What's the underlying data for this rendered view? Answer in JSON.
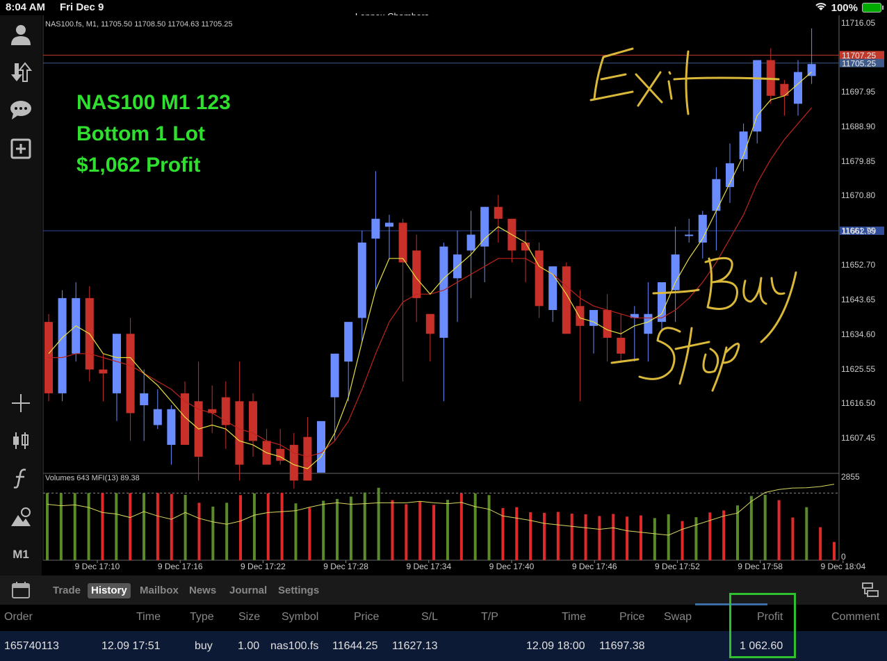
{
  "status_bar": {
    "time": "8:04 AM",
    "date": "Fri Dec 9",
    "title": "Lennox Chambers",
    "battery": "100%"
  },
  "sidebar": {
    "timeframe": "M1",
    "icons": [
      "account-icon",
      "trade-arrows-icon",
      "chat-icon",
      "add-chart-icon",
      "crosshair-icon",
      "candles-icon",
      "function-icon",
      "objects-icon"
    ]
  },
  "chart": {
    "header": "NAS100.fs, M1, 11705.50 11708.50 11704.63 11705.25",
    "overlay": [
      "NAS100 M1 123",
      "Bottom 1 Lot",
      "$1,062 Profit"
    ],
    "annotations": {
      "exit": "Exit",
      "buy": "Buy",
      "stop": "Stop"
    },
    "price_ticks": [
      "11716.05",
      "11697.95",
      "11688.90",
      "11679.85",
      "11670.80",
      "11661.75",
      "11652.70",
      "11643.65",
      "11634.60",
      "11625.55",
      "11616.50",
      "11607.45"
    ],
    "price_labels": [
      {
        "text": "11707.25",
        "value": 11707.25,
        "color": "#c0392b"
      },
      {
        "text": "11705.25",
        "value": 11705.25,
        "color": "#3d5a8a"
      },
      {
        "text": "11662.99",
        "value": 11662.99,
        "color": "#2e4c9a"
      }
    ],
    "time_ticks": [
      "9 Dec 17:10",
      "9 Dec 17:16",
      "9 Dec 17:22",
      "9 Dec 17:28",
      "9 Dec 17:34",
      "9 Dec 17:40",
      "9 Dec 17:46",
      "9 Dec 17:52",
      "9 Dec 17:58",
      "9 Dec 18:04"
    ],
    "volume_header": "Volumes 643 MFI(13) 89.38",
    "volume_ticks": [
      "2855",
      "0"
    ],
    "colors": {
      "bull": "#6b8cff",
      "bear": "#c8302a",
      "ma_fast": "#e8e040",
      "ma_slow": "#c0241e",
      "vol_up": "#5a8a2a",
      "vol_down": "#e02a2a",
      "text": "#cccccc",
      "overlay": "#2fe02f",
      "ink": "#d9b83a"
    }
  },
  "chart_data": {
    "type": "candlestick",
    "symbol": "NAS100.fs",
    "ylim": [
      11602,
      11717.3
    ],
    "candles": [
      [
        11640,
        11642,
        11620,
        11622
      ],
      [
        11622,
        11648,
        11620,
        11646
      ],
      [
        11632,
        11650,
        11630,
        11646
      ],
      [
        11646,
        11649,
        11625,
        11628
      ],
      [
        11628,
        11632,
        11620,
        11627
      ],
      [
        11622,
        11637,
        11615,
        11637
      ],
      [
        11637,
        11641,
        11610,
        11617
      ],
      [
        11619,
        11628,
        11610,
        11622
      ],
      [
        11614,
        11623,
        11613,
        11618
      ],
      [
        11609,
        11619,
        11604,
        11618
      ],
      [
        11622,
        11625,
        11610,
        11609
      ],
      [
        11620,
        11630,
        11600,
        11606
      ],
      [
        11618,
        11624,
        11612,
        11617
      ],
      [
        11621,
        11625,
        11608,
        11614
      ],
      [
        11620,
        11630,
        11600,
        11604
      ],
      [
        11620,
        11622,
        11606,
        11610
      ],
      [
        11610,
        11613,
        11606,
        11604
      ],
      [
        11608,
        11613,
        11604,
        11605
      ],
      [
        11609,
        11612,
        11598,
        11600
      ],
      [
        11611,
        11616,
        11602,
        11600
      ],
      [
        11602,
        11614,
        11602,
        11615
      ],
      [
        11621,
        11628,
        11610,
        11632
      ],
      [
        11630,
        11635,
        11620,
        11640
      ],
      [
        11641,
        11663,
        11635,
        11660
      ],
      [
        11661,
        11678,
        11648,
        11666
      ],
      [
        11664,
        11667,
        11656,
        11665
      ],
      [
        11665,
        11666,
        11625,
        11655
      ],
      [
        11658,
        11662,
        11640,
        11646
      ],
      [
        11642,
        11642,
        11630,
        11637
      ],
      [
        11636,
        11660,
        11620,
        11659
      ],
      [
        11651,
        11663,
        11640,
        11657
      ],
      [
        11658,
        11668,
        11646,
        11662
      ],
      [
        11659,
        11669,
        11650,
        11669
      ],
      [
        11669,
        11672,
        11660,
        11666
      ],
      [
        11666,
        11666,
        11655,
        11658
      ],
      [
        11660,
        11663,
        11650,
        11658
      ],
      [
        11658,
        11660,
        11641,
        11644
      ],
      [
        11643,
        11654,
        11640,
        11654
      ],
      [
        11654,
        11655,
        11640,
        11637
      ],
      [
        11644,
        11648,
        11620,
        11639
      ],
      [
        11639,
        11641,
        11632,
        11643
      ],
      [
        11643,
        11647,
        11630,
        11636
      ],
      [
        11636,
        11642,
        11630,
        11632
      ],
      [
        11641,
        11644,
        11630,
        11642
      ],
      [
        11637,
        11650,
        11630,
        11642
      ],
      [
        11640,
        11648,
        11638,
        11650
      ],
      [
        11648,
        11664,
        11640,
        11657
      ],
      [
        11662,
        11666,
        11660,
        11662
      ],
      [
        11660,
        11668,
        11656,
        11667
      ],
      [
        11668,
        11679,
        11658,
        11676
      ],
      [
        11674,
        11685,
        11670,
        11680
      ],
      [
        11681,
        11690,
        11678,
        11688
      ],
      [
        11688,
        11706,
        11685,
        11706
      ],
      [
        11706,
        11709,
        11695,
        11697
      ],
      [
        11700,
        11701,
        11692,
        11697
      ],
      [
        11695,
        11706,
        11692,
        11703
      ],
      [
        11702,
        11714,
        11700,
        11705
      ]
    ],
    "ma_fast": [
      11632,
      11636,
      11639,
      11637,
      11632,
      11631,
      11631,
      11627,
      11624,
      11620,
      11616,
      11613,
      11614,
      11613,
      11610,
      11609,
      11607,
      11606,
      11604,
      11603,
      11606,
      11612,
      11621,
      11635,
      11648,
      11656,
      11656,
      11651,
      11647,
      11651,
      11654,
      11657,
      11661,
      11664,
      11662,
      11660,
      11654,
      11652,
      11647,
      11641,
      11640,
      11638,
      11637,
      11639,
      11640,
      11642,
      11650,
      11656,
      11661,
      11668,
      11675,
      11682,
      11692,
      11696,
      11697,
      11700,
      11703
    ],
    "ma_slow": [
      11631,
      11631,
      11632,
      11632,
      11631,
      11630,
      11629,
      11627,
      11625,
      11623,
      11620,
      11618,
      11617,
      11615,
      11613,
      11612,
      11610,
      11609,
      11607,
      11606,
      11607,
      11610,
      11615,
      11623,
      11632,
      11640,
      11645,
      11647,
      11647,
      11648,
      11650,
      11652,
      11654,
      11656,
      11656,
      11656,
      11654,
      11652,
      11649,
      11646,
      11644,
      11643,
      11642,
      11641,
      11641,
      11641,
      11643,
      11646,
      11650,
      11655,
      11661,
      11667,
      11675,
      11681,
      11686,
      11690,
      11694
    ],
    "volume_range": [
      0,
      2855
    ],
    "volumes": [
      2280,
      2280,
      2280,
      2280,
      2280,
      2280,
      2280,
      2280,
      2280,
      2250,
      2220,
      1950,
      1820,
      1950,
      2210,
      2270,
      2270,
      2290,
      1930,
      1780,
      2020,
      2080,
      2160,
      2300,
      2460,
      2040,
      1900,
      1990,
      1880,
      2050,
      2270,
      2270,
      2210,
      1770,
      1800,
      1630,
      1610,
      1640,
      1580,
      1560,
      1500,
      1570,
      1480,
      1520,
      1430,
      1560,
      1330,
      1460,
      1620,
      1690,
      1860,
      2180,
      2220,
      2040,
      1450,
      1800,
      1120,
      620
    ],
    "volume_dir": [
      "up",
      "up",
      "up",
      "up",
      "down",
      "up",
      "down",
      "up",
      "down",
      "down",
      "up",
      "down",
      "up",
      "up",
      "down",
      "up",
      "down",
      "down",
      "up",
      "down",
      "up",
      "up",
      "up",
      "up",
      "up",
      "down",
      "down",
      "down",
      "down",
      "up",
      "down",
      "up",
      "up",
      "down",
      "down",
      "down",
      "down",
      "down",
      "down",
      "down",
      "down",
      "down",
      "down",
      "down",
      "up",
      "up",
      "down",
      "up",
      "down",
      "down",
      "up",
      "up",
      "up",
      "down",
      "down",
      "up",
      "down",
      "down"
    ],
    "mfi": [
      1900,
      1850,
      1880,
      1790,
      1620,
      1570,
      1450,
      1650,
      1500,
      1390,
      1620,
      1420,
      1300,
      1220,
      1330,
      1530,
      1620,
      1650,
      1680,
      1800,
      1900,
      1950,
      1900,
      1920,
      1950,
      1950,
      1950,
      2000,
      1950,
      1920,
      1960,
      1820,
      1730,
      1500,
      1430,
      1350,
      1250,
      1200,
      1150,
      1100,
      1050,
      1100,
      1000,
      950,
      900,
      850,
      1050,
      1200,
      1350,
      1500,
      1600,
      2000,
      2300,
      2400,
      2450,
      2460,
      2500,
      2580
    ]
  },
  "tabs": {
    "items": [
      {
        "label": "Trade",
        "active": false
      },
      {
        "label": "History",
        "active": true
      },
      {
        "label": "Mailbox",
        "active": false
      },
      {
        "label": "News",
        "active": false
      },
      {
        "label": "Journal",
        "active": false
      },
      {
        "label": "Settings",
        "active": false
      }
    ]
  },
  "history": {
    "headers": {
      "order": "Order",
      "time": "Time",
      "type": "Type",
      "size": "Size",
      "symbol": "Symbol",
      "price": "Price",
      "sl": "S/L",
      "tp": "T/P",
      "close_time": "Time",
      "close_price": "Price",
      "swap": "Swap",
      "profit": "Profit",
      "comment": "Comment"
    },
    "rows": [
      {
        "order": "165740113",
        "time": "12.09 17:51",
        "type": "buy",
        "size": "1.00",
        "symbol": "nas100.fs",
        "price": "11644.25",
        "sl": "11627.13",
        "tp": "",
        "close_time": "12.09 18:00",
        "close_price": "11697.38",
        "swap": "",
        "profit": "1 062.60",
        "comment": ""
      }
    ]
  }
}
